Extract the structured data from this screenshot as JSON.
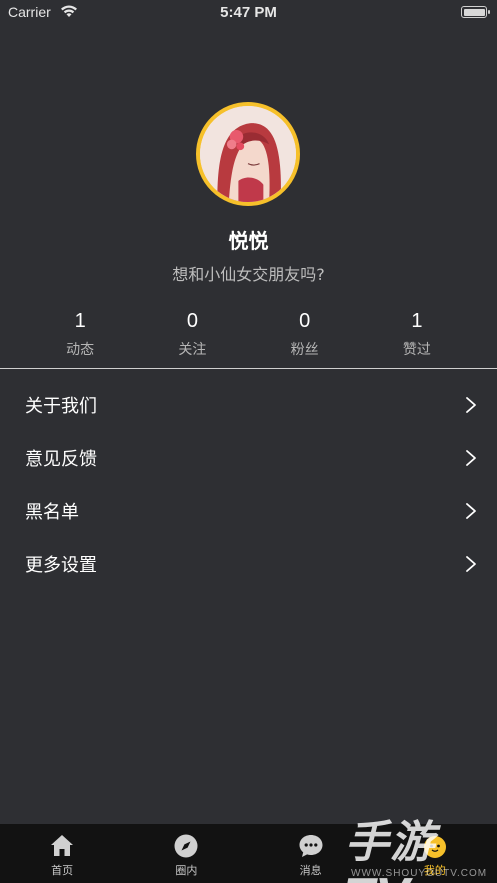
{
  "status_bar": {
    "carrier": "Carrier",
    "time": "5:47 PM"
  },
  "profile": {
    "name": "悦悦",
    "bio": "想和小仙女交朋友吗?"
  },
  "stats": [
    {
      "value": "1",
      "label": "动态"
    },
    {
      "value": "0",
      "label": "关注"
    },
    {
      "value": "0",
      "label": "粉丝"
    },
    {
      "value": "1",
      "label": "赞过"
    }
  ],
  "menu": [
    {
      "label": "关于我们"
    },
    {
      "label": "意见反馈"
    },
    {
      "label": "黑名单"
    },
    {
      "label": "更多设置"
    }
  ],
  "tabs": [
    {
      "label": "首页",
      "icon": "home-icon"
    },
    {
      "label": "圈内",
      "icon": "compass-icon"
    },
    {
      "label": "消息",
      "icon": "message-icon"
    },
    {
      "label": "我的",
      "icon": "profile-icon",
      "active": true
    }
  ],
  "watermark": {
    "main": "手游TV",
    "sub": "WWW.SHOUYOUTV.COM"
  },
  "colors": {
    "background": "#2e2f33",
    "accent": "#f6c02a",
    "tabbar": "#121212"
  }
}
